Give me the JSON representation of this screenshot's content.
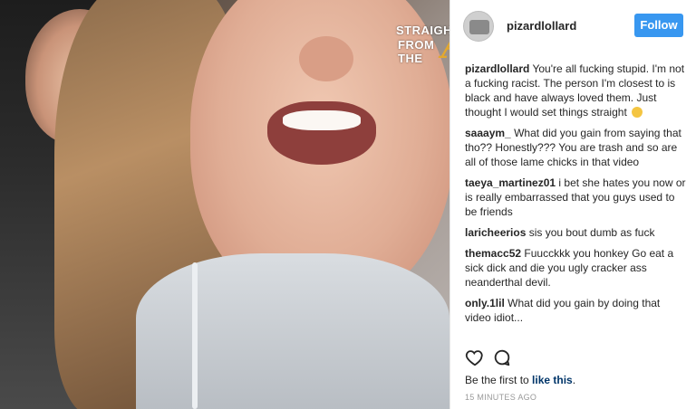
{
  "watermark": {
    "line1": "STRAIGHT",
    "line2": "FROM",
    "line3": "THE",
    "logo_letter": "A"
  },
  "post": {
    "username": "pizardlollard",
    "follow_label": "Follow"
  },
  "comments": [
    {
      "user": "pizardlollard",
      "text": "You're all fucking stupid. I'm not a fucking racist. The person I'm closest to is black and have always loved them. Just thought I would set things straight"
    },
    {
      "user": "saaaym_",
      "text": "What did you gain from saying that tho?? Honestly??? You are trash and so are all of those lame chicks in that video"
    },
    {
      "user": "taeya_martinez01",
      "text": "i bet she hates you now or is really embarrassed that you guys used to be friends"
    },
    {
      "user": "laricheerios",
      "text": "sis you bout dumb as fuck"
    },
    {
      "user": "themacc52",
      "text": "Fuucckkk you honkey Go eat a sick dick and die you ugly cracker ass neanderthal devil."
    },
    {
      "user": "only.1lil",
      "text": "What did you gain by doing that video idiot..."
    }
  ],
  "footer": {
    "likes_prefix": "Be the first to ",
    "likes_link": "like this",
    "likes_suffix": ".",
    "timestamp": "15 MINUTES AGO"
  },
  "icons": {
    "heart": "heart-icon",
    "comment": "comment-icon",
    "emoji": "sweat-smile-emoji"
  },
  "colors": {
    "follow_button": "#3897f0",
    "link": "#003569",
    "watermark_accent": "#e3a82f"
  }
}
